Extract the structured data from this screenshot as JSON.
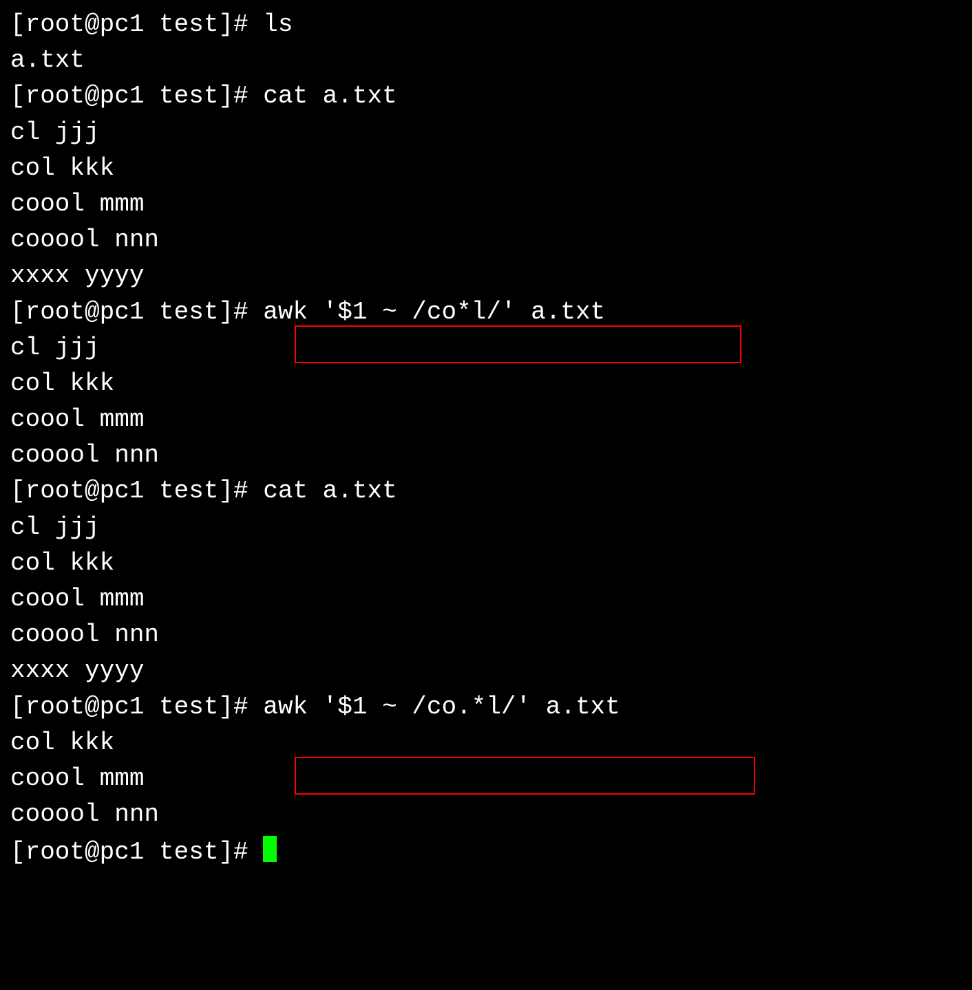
{
  "prompt": "[root@pc1 test]# ",
  "lines": {
    "l1_cmd": "ls",
    "l2": "a.txt",
    "l3_cmd": "cat a.txt",
    "l4": "cl jjj",
    "l5": "col kkk",
    "l6": "coool mmm",
    "l7": "cooool nnn",
    "l8": "xxxx yyyy",
    "l9_cmd": "awk '$1 ~ /co*l/' a.txt",
    "l10": "cl jjj",
    "l11": "col kkk",
    "l12": "coool mmm",
    "l13": "cooool nnn",
    "l14_cmd": "cat a.txt",
    "l15": "cl jjj",
    "l16": "col kkk",
    "l17": "coool mmm",
    "l18": "cooool nnn",
    "l19": "xxxx yyyy",
    "l20_cmd": "awk '$1 ~ /co.*l/' a.txt",
    "l21": "col kkk",
    "l22": "coool mmm",
    "l23": "cooool nnn"
  }
}
